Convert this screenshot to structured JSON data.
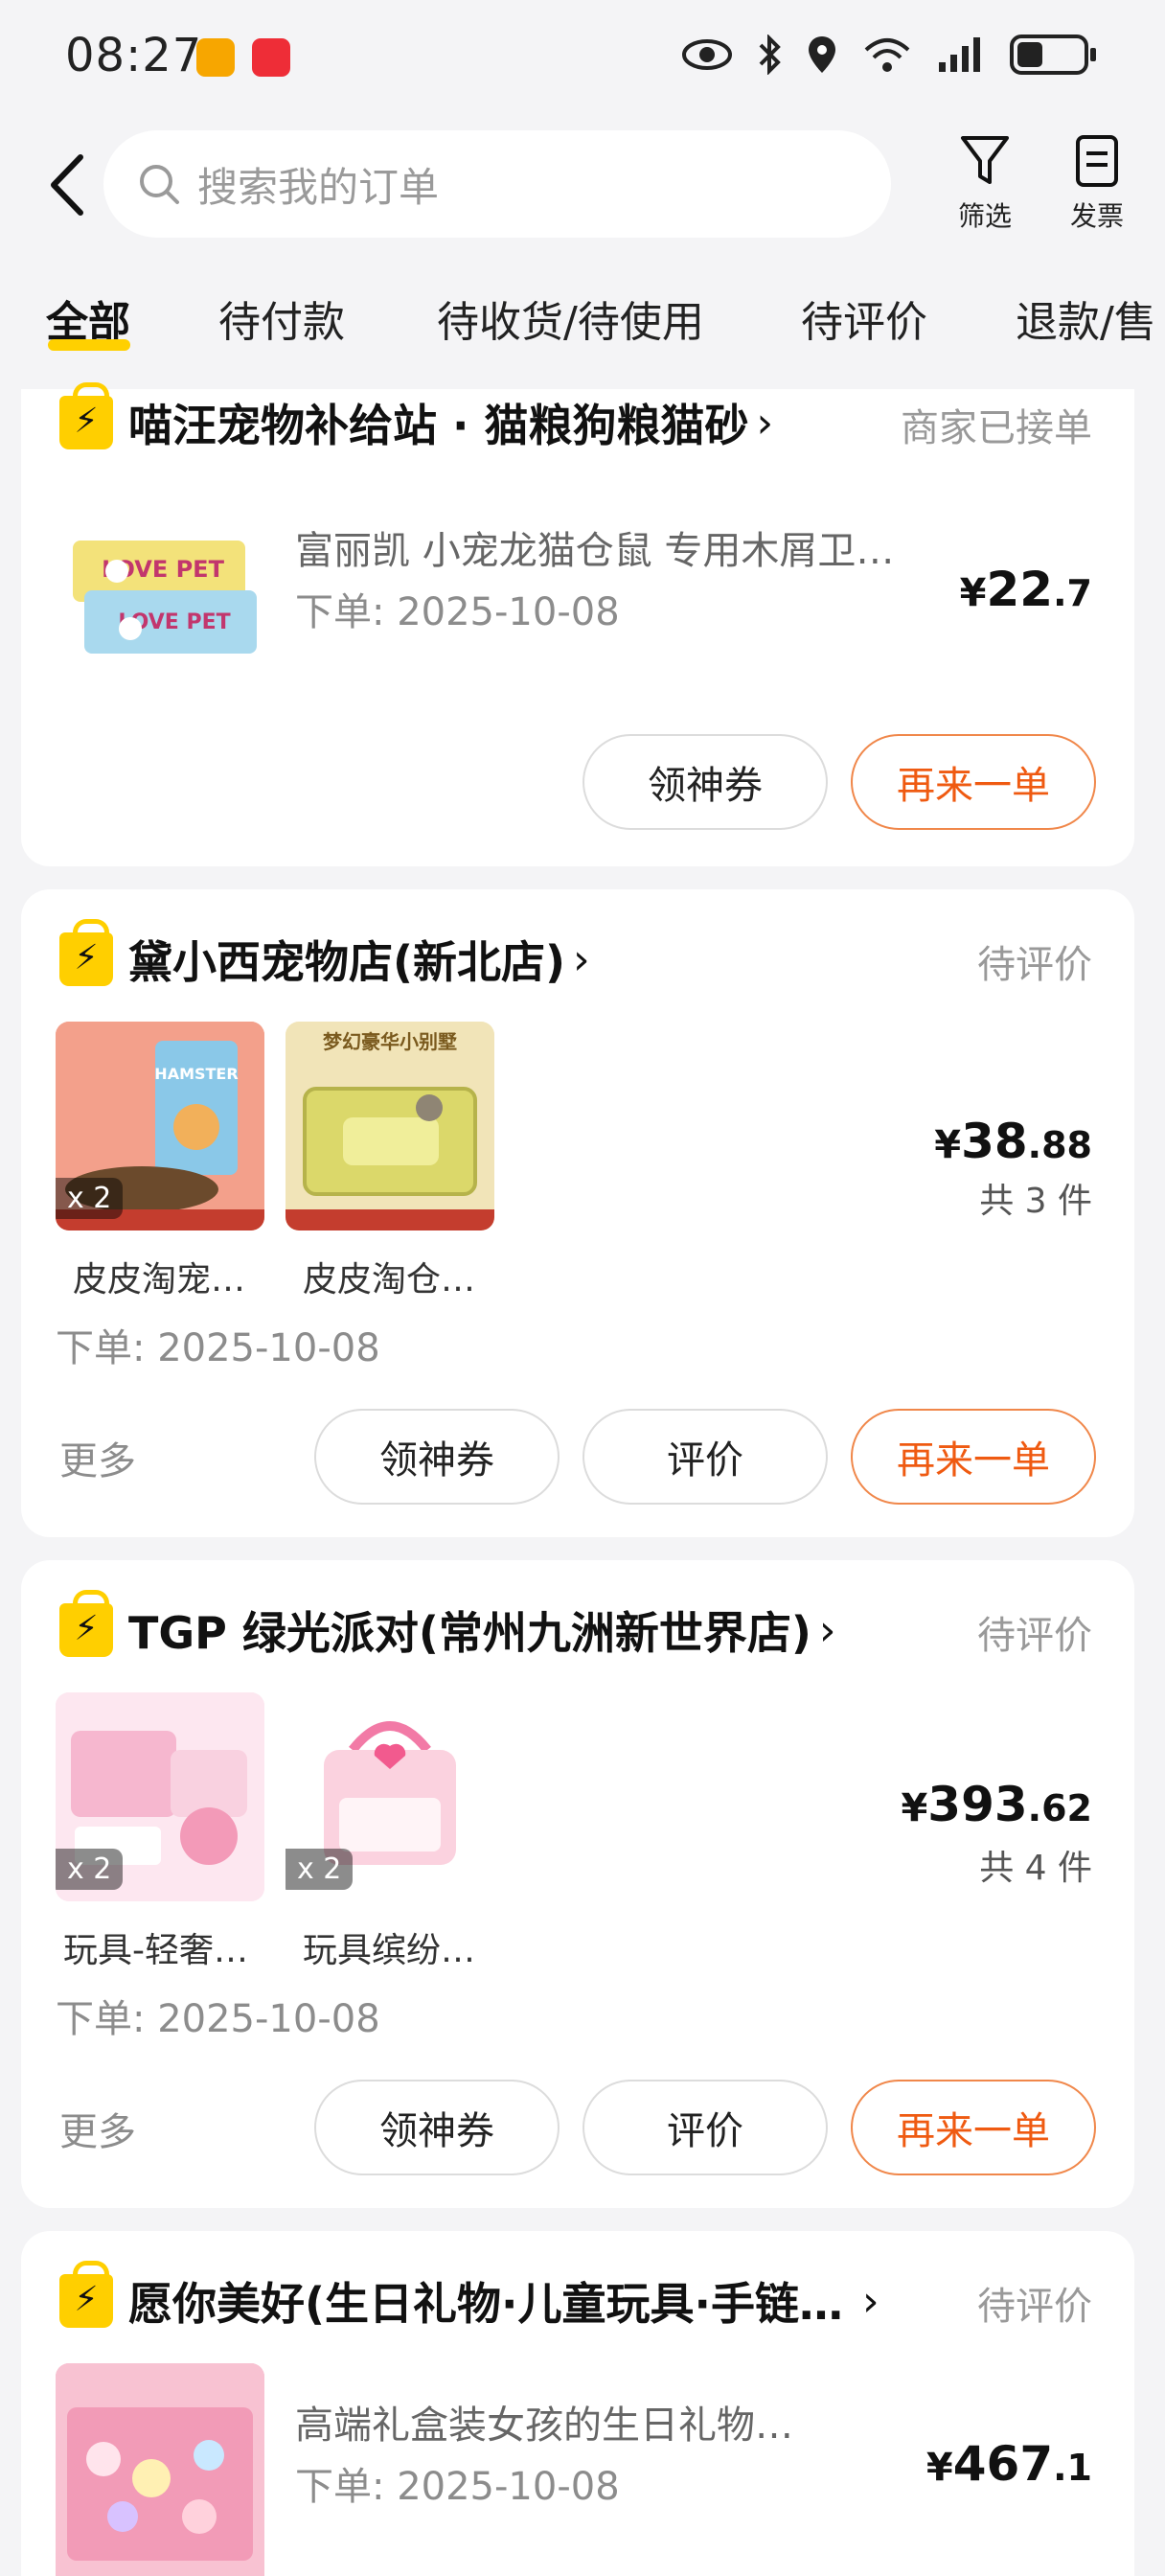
{
  "status_bar": {
    "time": "08:27"
  },
  "search": {
    "placeholder": "搜索我的订单"
  },
  "header": {
    "filter_label": "筛选",
    "invoice_label": "发票"
  },
  "tabs": [
    {
      "label": "全部",
      "active": true
    },
    {
      "label": "待付款"
    },
    {
      "label": "待收货/待使用"
    },
    {
      "label": "待评价"
    },
    {
      "label": "退款/售"
    }
  ],
  "orders": [
    {
      "shop": "喵汪宠物补给站 · 猫粮狗粮猫砂",
      "status": "商家已接单",
      "product_title": "富丽凯 小宠龙猫仓鼠 专用木屑卫…",
      "date": "下单: 2025-10-08",
      "price_symbol": "¥",
      "price_int": "22",
      "price_dec": ".7",
      "buttons": [
        "领神券",
        "再来一单"
      ]
    },
    {
      "shop": "黛小西宠物店(新北店)",
      "status": "待评价",
      "items": [
        {
          "name": "皮皮淘宠…",
          "qty": "x 2"
        },
        {
          "name": "皮皮淘仓…",
          "qty": ""
        }
      ],
      "date": "下单: 2025-10-08",
      "price_symbol": "¥",
      "price_int": "38",
      "price_dec": ".88",
      "count": "共 3 件",
      "more": "更多",
      "buttons": [
        "领神券",
        "评价",
        "再来一单"
      ]
    },
    {
      "shop": "TGP 绿光派对(常州九洲新世界店)",
      "status": "待评价",
      "items": [
        {
          "name": "玩具-轻奢…",
          "qty": "x 2"
        },
        {
          "name": "玩具缤纷…",
          "qty": "x 2"
        }
      ],
      "date": "下单: 2025-10-08",
      "price_symbol": "¥",
      "price_int": "393",
      "price_dec": ".62",
      "count": "共 4 件",
      "more": "更多",
      "buttons": [
        "领神券",
        "评价",
        "再来一单"
      ]
    },
    {
      "shop": "愿你美好(生日礼物·儿童玩具·手链…",
      "status": "待评价",
      "product_title": "高端礼盒装女孩的生日礼物…",
      "date": "下单: 2025-10-08",
      "price_symbol": "¥",
      "price_int": "467",
      "price_dec": ".1"
    }
  ],
  "thumb_labels": {
    "love_pet": "LOVE PET",
    "hamster": "HAMSTER",
    "villa": "梦幻豪华小别墅"
  },
  "colors": {
    "accent_yellow": "#ffd000",
    "action_orange": "#ef5a11",
    "bg": "#f4f4f6"
  }
}
